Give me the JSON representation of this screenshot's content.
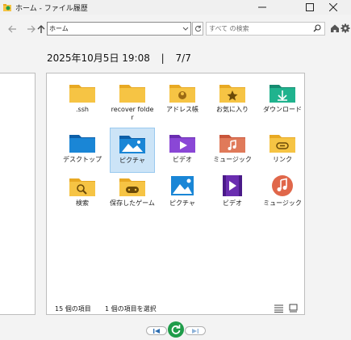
{
  "window": {
    "title": "ホーム - ファイル履歴"
  },
  "address": {
    "path": "ホーム"
  },
  "search": {
    "placeholder": "すべて の検索"
  },
  "status": {
    "datetime": "2025年10月5日 19:08",
    "separator": "|",
    "page": "7/7"
  },
  "items": [
    {
      "label": ".ssh",
      "icon": "folder-icon"
    },
    {
      "label": "recover folder",
      "icon": "folder-icon"
    },
    {
      "label": "アドレス帳",
      "icon": "contacts-folder-icon"
    },
    {
      "label": "お気に入り",
      "icon": "favorites-folder-icon"
    },
    {
      "label": "ダウンロード",
      "icon": "downloads-folder-icon"
    },
    {
      "label": "デスクトップ",
      "icon": "desktop-folder-icon"
    },
    {
      "label": "ピクチャ",
      "icon": "pictures-folder-icon",
      "selected": true
    },
    {
      "label": "ビデオ",
      "icon": "videos-folder-icon"
    },
    {
      "label": "ミュージック",
      "icon": "music-folder-icon"
    },
    {
      "label": "リンク",
      "icon": "links-folder-icon"
    },
    {
      "label": "検索",
      "icon": "searches-folder-icon"
    },
    {
      "label": "保存したゲーム",
      "icon": "saved-games-folder-icon"
    },
    {
      "label": "ピクチャ",
      "icon": "pictures-library-icon"
    },
    {
      "label": "ビデオ",
      "icon": "videos-library-icon"
    },
    {
      "label": "ミュージック",
      "icon": "music-library-icon"
    }
  ],
  "footer": {
    "item_count": "15 個の項目",
    "selected_count": "1 個の項目を選択"
  },
  "colors": {
    "folder": "#f6c444",
    "selected_bg": "#cce4f7",
    "restore_green": "#1f9c4a"
  }
}
